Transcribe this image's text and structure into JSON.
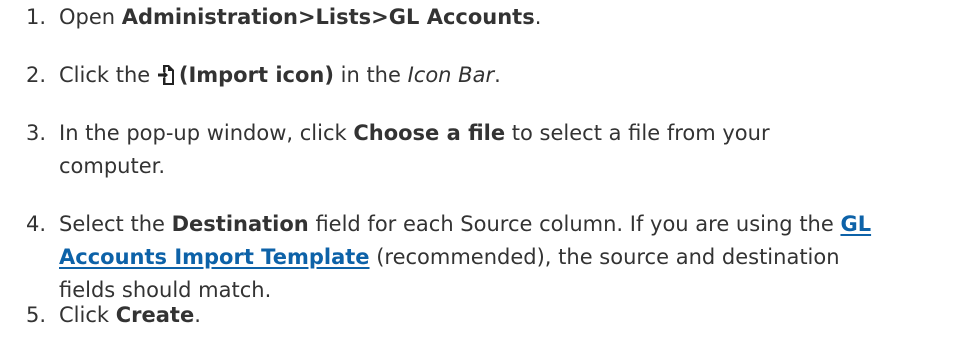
{
  "steps": [
    {
      "number": "1.",
      "pre": "Open ",
      "bold": "Administration>Lists>GL Accounts",
      "post": "."
    },
    {
      "number": "2.",
      "pre": "Click the ",
      "icon": "import-icon",
      "bold": "(Import icon)",
      "mid": " in the ",
      "italic": "Icon Bar",
      "post": "."
    },
    {
      "number": "3.",
      "pre": "In the pop-up window, click ",
      "bold": "Choose a file",
      "post_line1": " to select a file from your",
      "post_line2": "computer."
    },
    {
      "number": "4.",
      "pre": "Select the ",
      "bold": "Destination",
      "mid": " field for each Source column. If you are using the ",
      "link_part1": "GL",
      "link_part2": "Accounts Import Template",
      "post_line2": " (recommended), the source and destination",
      "post_line3": "fields should match."
    },
    {
      "number": "5.",
      "pre": "Click ",
      "bold": "Create",
      "post": "."
    }
  ],
  "colors": {
    "text": "#333333",
    "link": "#0d62a8"
  }
}
